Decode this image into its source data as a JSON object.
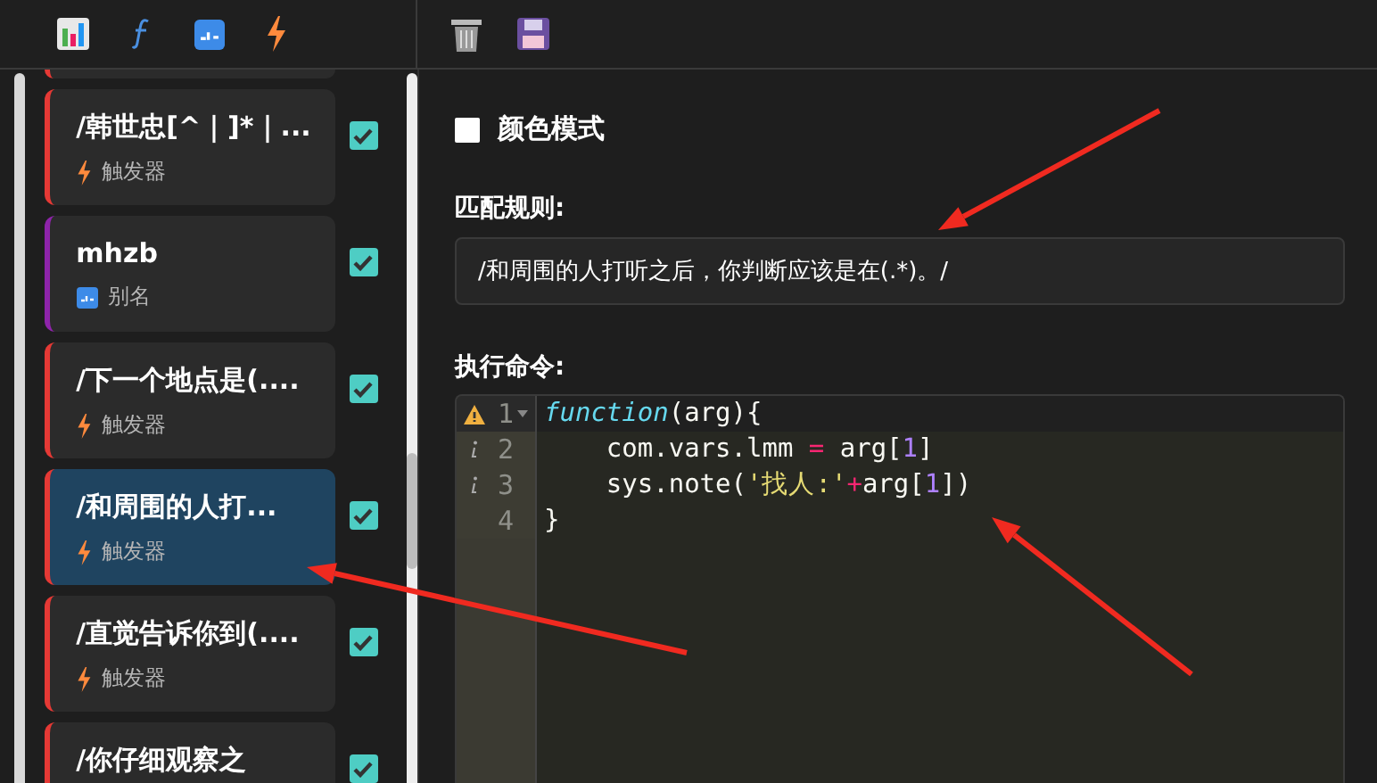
{
  "toolbar": {
    "left_tools": [
      {
        "kind": "chart"
      },
      {
        "kind": "function"
      },
      {
        "kind": "alias"
      },
      {
        "kind": "trigger"
      }
    ],
    "right_tools": [
      {
        "kind": "trash"
      },
      {
        "kind": "save"
      }
    ]
  },
  "sidebar": {
    "items": [
      {
        "title": "/韩世忠[^｜]*｜...",
        "type_label": "触发器",
        "kind": "trigger",
        "checked": true,
        "selected": false
      },
      {
        "title": "mhzb",
        "type_label": "别名",
        "kind": "alias",
        "checked": true,
        "selected": false
      },
      {
        "title": "/下一个地点是(....",
        "type_label": "触发器",
        "kind": "trigger",
        "checked": true,
        "selected": false
      },
      {
        "title": "/和周围的人打...",
        "type_label": "触发器",
        "kind": "trigger",
        "checked": true,
        "selected": true
      },
      {
        "title": "/直觉告诉你到(....",
        "type_label": "触发器",
        "kind": "trigger",
        "checked": true,
        "selected": false
      },
      {
        "title": "/你仔细观察之",
        "kind": "trigger",
        "checked": true,
        "selected": false
      }
    ]
  },
  "editor": {
    "color_mode": {
      "label": "颜色模式",
      "checked": false
    },
    "match_rule": {
      "label": "匹配规则:",
      "value": "/和周围的人打听之后，你判断应该是在(.*)。/"
    },
    "command": {
      "label": "执行命令:",
      "lines": [
        {
          "number": "1",
          "kind": "warning",
          "foldable": true,
          "active": true,
          "tokens": [
            {
              "kind": "keyword",
              "text": "function"
            },
            {
              "kind": "plain",
              "text": "(arg){"
            }
          ]
        },
        {
          "number": "2",
          "kind": "info",
          "foldable": false,
          "active": false,
          "tokens": [
            {
              "kind": "plain",
              "text": "    com.vars.lmm "
            },
            {
              "kind": "operator",
              "text": "="
            },
            {
              "kind": "plain",
              "text": " arg["
            },
            {
              "kind": "number",
              "text": "1"
            },
            {
              "kind": "plain",
              "text": "]"
            }
          ]
        },
        {
          "number": "3",
          "kind": "info",
          "foldable": false,
          "active": false,
          "tokens": [
            {
              "kind": "plain",
              "text": "    sys.note("
            },
            {
              "kind": "string",
              "text": "'找人:'"
            },
            {
              "kind": "operator",
              "text": "+"
            },
            {
              "kind": "plain",
              "text": "arg["
            },
            {
              "kind": "number",
              "text": "1"
            },
            {
              "kind": "plain",
              "text": "])"
            }
          ]
        },
        {
          "number": "4",
          "kind": "plain",
          "foldable": false,
          "active": false,
          "tokens": [
            {
              "kind": "plain",
              "text": "}"
            }
          ]
        }
      ]
    }
  }
}
